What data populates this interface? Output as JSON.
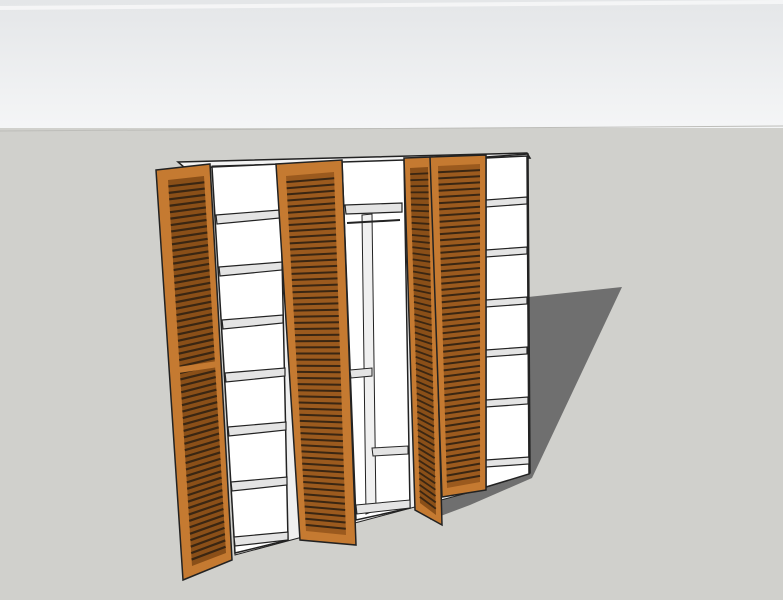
{
  "scene": {
    "subject": "wardrobe-with-louvered-doors",
    "style": "sketchup-3d-model",
    "colors": {
      "sky_top": "#e6e8ea",
      "sky_bottom": "#f4f5f6",
      "ground": "#d0d0cc",
      "shadow": "#6e6e6e",
      "carcass": "#ffffff",
      "carcass_shade": "#e9e9e9",
      "edge": "#222222",
      "wood": "#c57a31",
      "wood_dark": "#8a4f18",
      "slat_dark": "#3a2612"
    }
  }
}
